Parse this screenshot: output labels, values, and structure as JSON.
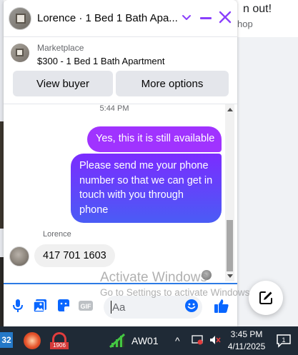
{
  "background": {
    "right_line1": "n out!",
    "right_line2": "hop"
  },
  "header": {
    "title": "Lorence · 1 Bed 1 Bath Apa...",
    "chevron_icon": "chevron-down-icon",
    "minimize_icon": "minimize-icon",
    "close_icon": "close-icon",
    "accent_color": "#8a3ffc"
  },
  "marketplace": {
    "label": "Marketplace",
    "listing": "$300 - 1 Bed 1 Bath Apartment",
    "view_buyer": "View buyer",
    "more_options": "More options"
  },
  "conversation": {
    "timestamp": "5:44 PM",
    "messages": [
      {
        "direction": "outgoing",
        "text": "Yes, this it is still available"
      },
      {
        "direction": "outgoing",
        "text": "Please send me your phone number so that we can get in touch with you through phone"
      },
      {
        "direction": "incoming",
        "sender": "Lorence",
        "text": "417 701 1603"
      }
    ]
  },
  "composer": {
    "placeholder": "Aa",
    "icons": [
      "microphone-icon",
      "photo-icon",
      "sticker-icon",
      "gif-icon",
      "emoji-icon",
      "like-icon"
    ]
  },
  "watermark": {
    "title": "Activate Windows",
    "subtitle": "Go to Settings to activate Windows."
  },
  "taskbar": {
    "badge": "32",
    "app2_label": "1906",
    "network_label": "AW01",
    "tray_chevron": "^",
    "time": "3:45 PM",
    "date": "4/11/2025",
    "notification_count": "1"
  }
}
